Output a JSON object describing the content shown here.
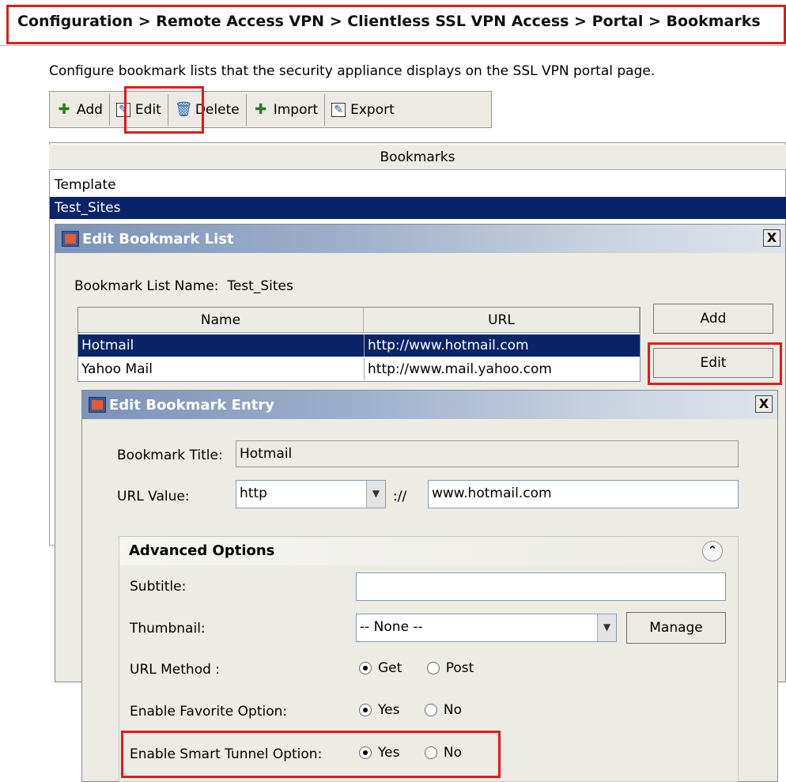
{
  "breadcrumb": "Configuration > Remote Access VPN > Clientless SSL VPN Access > Portal > Bookmarks",
  "description": "Configure bookmark lists that the security appliance displays on the SSL VPN portal page.",
  "toolbar": {
    "add": "Add",
    "edit": "Edit",
    "delete": "Delete",
    "import": "Import",
    "export": "Export"
  },
  "bookmarks": {
    "header": "Bookmarks",
    "rows": [
      "Template",
      "Test_Sites"
    ]
  },
  "edit_list_dialog": {
    "title": "Edit Bookmark List",
    "list_name_label": "Bookmark List Name:",
    "list_name_value": "Test_Sites",
    "columns": [
      "Name",
      "URL"
    ],
    "rows": [
      {
        "name": "Hotmail",
        "url": "http://www.hotmail.com"
      },
      {
        "name": "Yahoo Mail",
        "url": "http://www.mail.yahoo.com"
      }
    ],
    "add_button": "Add",
    "edit_button": "Edit",
    "close": "X"
  },
  "edit_entry_dialog": {
    "title": "Edit Bookmark Entry",
    "close": "X",
    "bookmark_title_label": "Bookmark Title:",
    "bookmark_title_value": "Hotmail",
    "url_value_label": "URL Value:",
    "url_scheme": "http",
    "url_sep": "://",
    "url_value": "www.hotmail.com",
    "advanced": {
      "header": "Advanced Options",
      "subtitle_label": "Subtitle:",
      "subtitle_value": "",
      "thumbnail_label": "Thumbnail:",
      "thumbnail_value": "-- None --",
      "manage_button": "Manage",
      "url_method_label": "URL Method :",
      "url_method_options": [
        "Get",
        "Post"
      ],
      "url_method_selected": "Get",
      "favorite_label": "Enable Favorite Option:",
      "favorite_options": [
        "Yes",
        "No"
      ],
      "favorite_selected": "Yes",
      "smart_tunnel_label": "Enable Smart Tunnel Option:",
      "smart_tunnel_options": [
        "Yes",
        "No"
      ],
      "smart_tunnel_selected": "Yes"
    }
  },
  "colors": {
    "highlight_box": "#e01b1b",
    "selection": "#0a246a",
    "dialog_bg": "#ecebe4"
  }
}
